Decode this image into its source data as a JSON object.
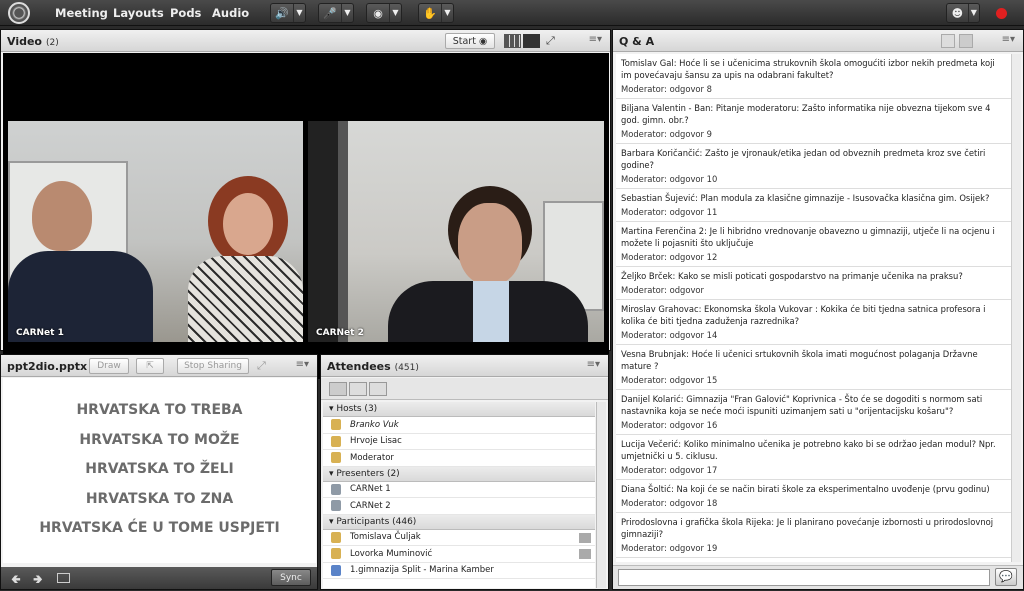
{
  "topbar": {
    "menus": [
      "Meeting",
      "Layouts",
      "Pods",
      "Audio"
    ],
    "icons": [
      "speaker-icon",
      "microphone-icon",
      "camera-icon",
      "raise-hand-icon"
    ],
    "status_color": "#e02020"
  },
  "video": {
    "title": "Video",
    "count": "(2)",
    "start_label": "Start",
    "feeds": [
      {
        "label": "CARNet 1"
      },
      {
        "label": "CARNet 2"
      }
    ]
  },
  "share": {
    "title": "ppt2dio.pptx",
    "draw_label": "Draw",
    "stop_label": "Stop Sharing",
    "sync_label": "Sync",
    "slide_lines": [
      "HRVATSKA TO TREBA",
      "HRVATSKA TO MOŽE",
      "HRVATSKA TO ŽELI",
      "HRVATSKA TO ZNA",
      "HRVATSKA ĆE U TOME USPJETI"
    ]
  },
  "attendees": {
    "title": "Attendees",
    "count": "(451)",
    "sections": [
      {
        "label": "Hosts (3)",
        "people": [
          "Branko Vuk",
          "Hrvoje Lisac",
          "Moderator"
        ]
      },
      {
        "label": "Presenters (2)",
        "people": [
          "CARNet 1",
          "CARNet 2"
        ]
      },
      {
        "label": "Participants (446)",
        "people": [
          "Tomislava Čuljak",
          "Lovorka Muminović",
          "1.gimnazija Split - Marina Kamber"
        ]
      }
    ]
  },
  "qa": {
    "title": "Q & A",
    "items": [
      {
        "q": "Tomislav Gal: Hoće li se i učenicima strukovnih škola omogućiti izbor nekih predmeta koji im povećavaju šansu za upis na odabrani fakultet?",
        "a": "Moderator: odgovor 8"
      },
      {
        "q": "Biljana Valentin - Ban: Pitanje moderatoru: Zašto informatika nije obvezna tijekom sve 4 god. gimn. obr.?",
        "a": "Moderator: odgovor 9"
      },
      {
        "q": "Barbara Koričančić: Zašto je vjronauk/etika jedan od obveznih predmeta kroz sve četiri godine?",
        "a": "Moderator: odgovor 10"
      },
      {
        "q": "Sebastian Šujević: Plan modula za klasične gimnazije - Isusovačka klasična gim. Osijek?",
        "a": "Moderator: odgovor 11"
      },
      {
        "q": "Martina Ferenčina 2: Je li hibridno vrednovanje obavezno u gimnaziji, utječe li na ocjenu i možete li pojasniti što uključuje",
        "a": "Moderator: odgovor 12"
      },
      {
        "q": "Željko Brček: Kako se misli poticati gospodarstvo na primanje učenika na praksu?",
        "a": "Moderator: odgovor"
      },
      {
        "q": "Miroslav Grahovac: Ekonomska škola Vukovar : Kokika će biti tjedna satnica profesora i kolika će biti tjedna zaduženja razrednika?",
        "a": "Moderator: odgovor 14"
      },
      {
        "q": "Vesna Brubnjak: Hoće li učenici srtukovnih škola imati mogućnost polaganja Državne mature ?",
        "a": "Moderator: odgovor 15"
      },
      {
        "q": "Danijel Kolarić: Gimnazija \"Fran Galović\" Koprivnica - Što će se dogoditi s normom sati nastavnika koja se neće moći ispuniti uzimanjem sati u \"orijentacijsku košaru\"?",
        "a": "Moderator: odgovor 16"
      },
      {
        "q": "Lucija Večerić: Koliko minimalno učenika je potrebno kako bi se održao jedan modul? Npr. umjetnički u 5. ciklusu.",
        "a": "Moderator: odgovor 17"
      },
      {
        "q": "Diana Šoltić: Na koji će se način birati škole za eksperimentalno uvođenje (prvu godinu)",
        "a": "Moderator: odgovor 18"
      },
      {
        "q": "Prirodoslovna i grafička škola Rijeka: Je li planirano povećanje izbornosti u prirodoslovnoj gimnaziji?",
        "a": "Moderator: odgovor 19"
      }
    ],
    "input_placeholder": ""
  }
}
